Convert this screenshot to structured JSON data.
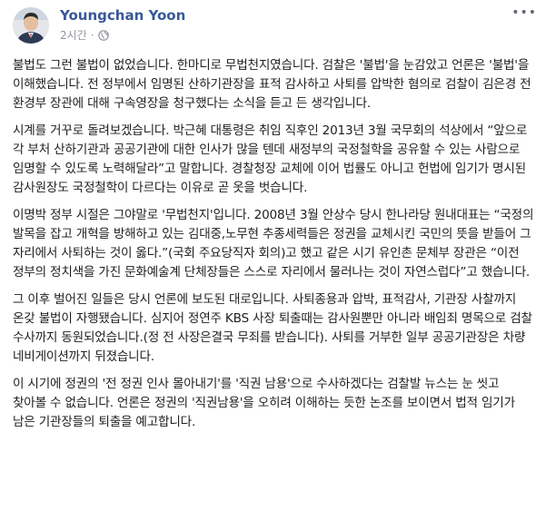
{
  "post": {
    "author": "Youngchan Yoon",
    "timestamp": "2시간",
    "separator": "·",
    "audience_icon": "globe-icon",
    "menu_icon": "more-options-icon",
    "paragraphs": [
      "불법도 그런 불법이 없었습니다. 한마디로 무법천지였습니다. 검찰은 '불법'을 눈감았고 언론은 '불법'을 이해했습니다. 전 정부에서 임명된 산하기관장을 표적 감사하고 사퇴를 압박한 혐의로 검찰이 김은경 전 환경부 장관에 대해 구속영장을 청구했다는 소식을 듣고 든 생각입니다.",
      "시계를 거꾸로 돌려보겠습니다. 박근혜 대통령은 취임 직후인 2013년 3월 국무회의 석상에서 “앞으로 각 부처 산하기관과 공공기관에 대한 인사가 많을 텐데 새정부의 국정철학을 공유할 수 있는 사람으로 임명할 수 있도록 노력해달라”고 말합니다. 경찰청장 교체에 이어 법률도 아니고 헌법에 임기가 명시된 감사원장도 국정철학이 다르다는 이유로 곧 옷을 벗습니다.",
      "이명박 정부 시절은 그야말로 '무법천지'입니다. 2008년 3월 안상수 당시 한나라당 원내대표는 “국정의 발목을 잡고 개혁을 방해하고 있는 김대중,노무현 추종세력들은 정권을 교체시킨 국민의 뜻을 받들어 그 자리에서 사퇴하는 것이 옳다.”(국회 주요당직자 회의)고 했고 같은 시기 유인촌 문체부 장관은 “이전 정부의 정치색을 가진 문화예술계 단체장들은 스스로 자리에서 물러나는 것이 자연스럽다”고 했습니다.",
      "그 이후 벌어진 일들은 당시 언론에 보도된 대로입니다. 사퇴종용과 압박, 표적감사, 기관장 사찰까지 온갖 불법이 자행됐습니다. 심지어 정연주 KBS 사장 퇴출때는 감사원뿐만 아니라 배임죄 명목으로 검찰 수사까지 동원되었습니다.(정 전 사장은결국 무죄를 받습니다). 사퇴를 거부한 일부 공공기관장은 차량 네비게이션까지 뒤졌습니다.",
      "이 시기에 정권의 '전 정권 인사 몰아내기'를 '직권 남용'으로 수사하겠다는 검찰발 뉴스는 눈 씻고 찾아볼 수 없습니다. 언론은 정권의 '직권남용'을 오히려 이해하는 듯한 논조를 보이면서 법적 임기가 남은 기관장들의 퇴출을 예고합니다."
    ]
  }
}
